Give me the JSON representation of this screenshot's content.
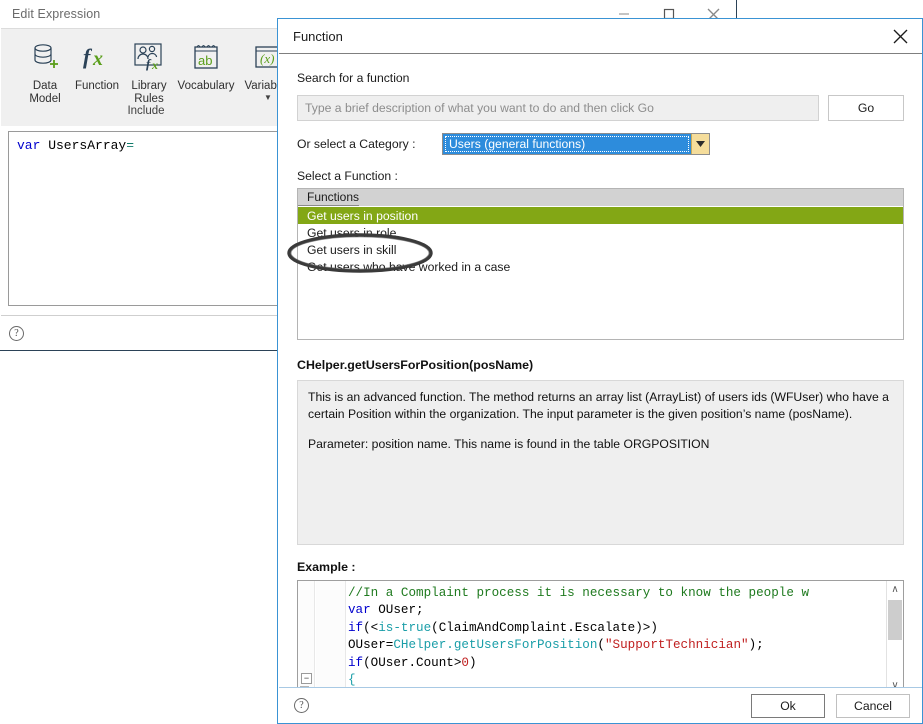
{
  "background_window": {
    "title": "Edit Expression",
    "window_buttons": [
      {
        "name": "minimize",
        "glyph": "minimize-icon"
      },
      {
        "name": "maximize",
        "glyph": "maximize-icon"
      },
      {
        "name": "close",
        "glyph": "close-icon"
      }
    ],
    "ribbon": {
      "group_label": "Include",
      "items": [
        {
          "label": "Data\nModel",
          "icon": "database-add-icon",
          "caret": false
        },
        {
          "label": "Function",
          "icon": "fx-icon",
          "caret": false
        },
        {
          "label": "Library\nRules",
          "icon": "people-fx-icon",
          "caret": false
        },
        {
          "label": "Vocabulary",
          "icon": "notepad-ab-icon",
          "caret": false
        },
        {
          "label": "Variables",
          "icon": "variable-x-icon",
          "caret": true
        }
      ]
    },
    "editor": {
      "code_keyword": "var",
      "code_identifier": " UsersArray",
      "code_operator": "="
    },
    "help_icon": "?"
  },
  "dialog": {
    "title": "Function",
    "close_icon": "close-icon",
    "search": {
      "label": "Search for a function",
      "placeholder": "Type a brief description of what you want to do and then click Go",
      "value": "",
      "go_label": "Go"
    },
    "category": {
      "label": "Or select a Category :",
      "selected": "Users (general functions)",
      "options": [
        "Users (general functions)"
      ]
    },
    "function_list": {
      "label": "Select a Function :",
      "column_header": "Functions",
      "selected_index": 0,
      "highlight_color": "#83a715",
      "items": [
        "Get users in position",
        "Get users in role",
        "Get users in skill",
        "Get users who have worked in a case"
      ]
    },
    "annotation": {
      "type": "hand-drawn-oval",
      "target": "Get users in position",
      "color": "#3a3a3a"
    },
    "signature": "CHelper.getUsersForPosition(posName)",
    "description_paragraphs": [
      "This is an advanced function. The method returns an array list (ArrayList) of users ids (WFUser) who have a certain Position within the organization. The input parameter is the given position’s name (posName).",
      "Parameter: position name. This name is found in the table ORGPOSITION"
    ],
    "example": {
      "label": "Example :",
      "code_lines": [
        [
          {
            "t": "//In a Complaint process it is necessary to know the people w",
            "c": "comment"
          }
        ],
        [
          {
            "t": "var",
            "c": "keyword"
          },
          {
            "t": " OUser;",
            "c": "plain"
          }
        ],
        [
          {
            "t": "if",
            "c": "keyword"
          },
          {
            "t": "(<",
            "c": "plain"
          },
          {
            "t": "is-true",
            "c": "type"
          },
          {
            "t": "(ClaimAndComplaint.Escalate)>)",
            "c": "plain"
          }
        ],
        [
          {
            "t": "OUser=",
            "c": "plain"
          },
          {
            "t": "CHelper.getUsersForPosition",
            "c": "type"
          },
          {
            "t": "(",
            "c": "plain"
          },
          {
            "t": "\"SupportTechnician\"",
            "c": "string"
          },
          {
            "t": ");",
            "c": "plain"
          }
        ],
        [
          {
            "t": "if",
            "c": "keyword"
          },
          {
            "t": "(OUser.Count>",
            "c": "plain"
          },
          {
            "t": "0",
            "c": "number"
          },
          {
            "t": ")",
            "c": "plain"
          }
        ],
        [
          {
            "t": "{",
            "c": "type"
          }
        ]
      ],
      "collapse_glyph": "−",
      "scroll_up_glyph": "∧",
      "scroll_down_glyph": "∨",
      "scroll_left_glyph": "‹",
      "scroll_right_glyph": "›"
    },
    "footer": {
      "help_icon": "?",
      "ok_label": "Ok",
      "cancel_label": "Cancel"
    }
  }
}
